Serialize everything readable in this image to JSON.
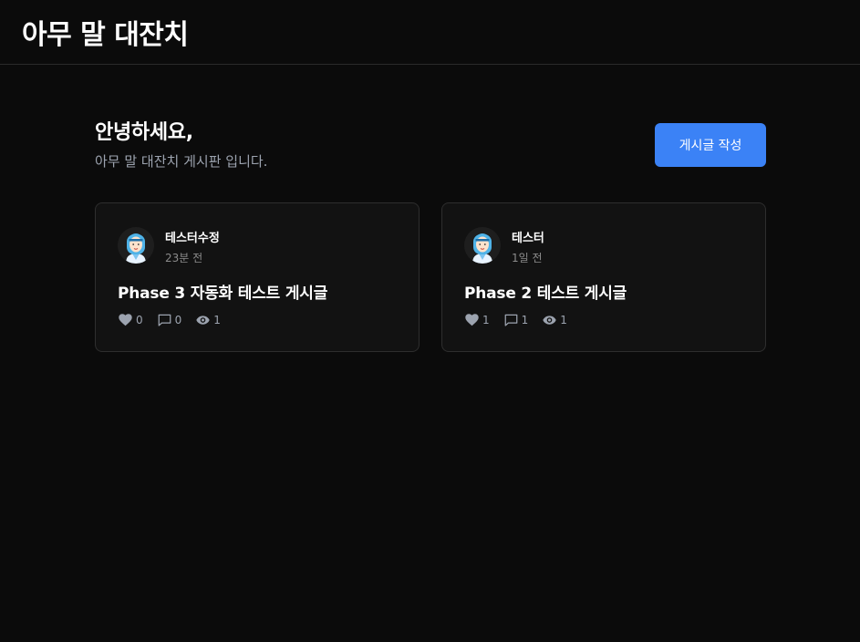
{
  "header": {
    "title": "아무 말 대잔치"
  },
  "hero": {
    "greeting": "안녕하세요,",
    "subtitle": "아무 말 대잔치 게시판 입니다.",
    "write_button": "게시글 작성"
  },
  "posts": [
    {
      "author": "테스터수정",
      "time": "23분 전",
      "title": "Phase 3 자동화 테스트 게시글",
      "likes": "0",
      "comments": "0",
      "views": "1"
    },
    {
      "author": "테스터",
      "time": "1일 전",
      "title": "Phase 2 테스트 게시글",
      "likes": "1",
      "comments": "1",
      "views": "1"
    }
  ],
  "icons": {
    "like": "heart-icon",
    "comment": "comment-icon",
    "view": "eye-icon"
  },
  "colors": {
    "background": "#0b0b0b",
    "card": "#121212",
    "accent": "#3b82f6",
    "muted_text": "#9ca3af"
  }
}
